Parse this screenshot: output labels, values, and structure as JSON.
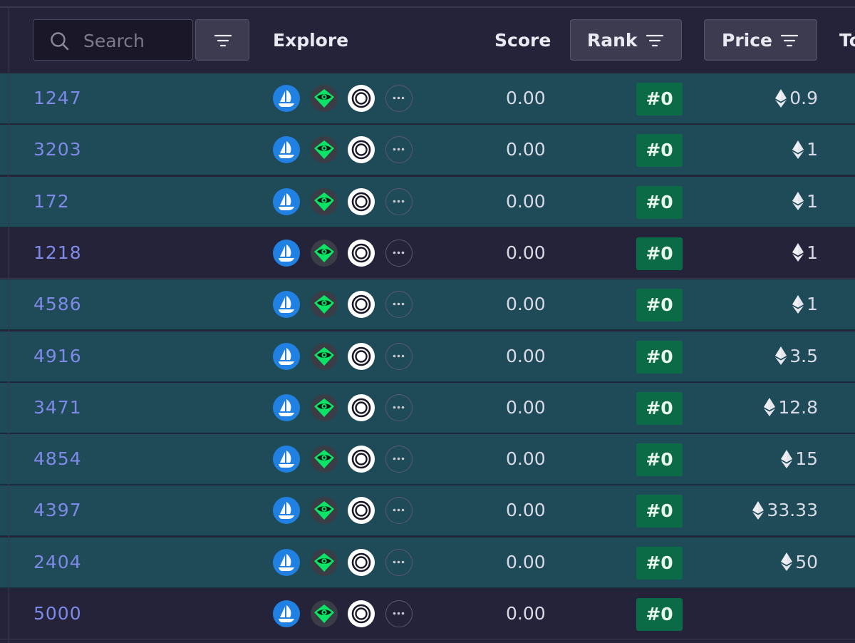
{
  "header": {
    "search_placeholder": "Search",
    "explore_label": "Explore",
    "score_label": "Score",
    "rank_label": "Rank",
    "price_label": "Price",
    "cutoff_label": "To"
  },
  "rows": [
    {
      "id": "1247",
      "score": "0.00",
      "rank": "#0",
      "price": "0.9",
      "selected": true
    },
    {
      "id": "3203",
      "score": "0.00",
      "rank": "#0",
      "price": "1",
      "selected": true
    },
    {
      "id": "172",
      "score": "0.00",
      "rank": "#0",
      "price": "1",
      "selected": true
    },
    {
      "id": "1218",
      "score": "0.00",
      "rank": "#0",
      "price": "1",
      "selected": false
    },
    {
      "id": "4586",
      "score": "0.00",
      "rank": "#0",
      "price": "1",
      "selected": true
    },
    {
      "id": "4916",
      "score": "0.00",
      "rank": "#0",
      "price": "3.5",
      "selected": true
    },
    {
      "id": "3471",
      "score": "0.00",
      "rank": "#0",
      "price": "12.8",
      "selected": true
    },
    {
      "id": "4854",
      "score": "0.00",
      "rank": "#0",
      "price": "15",
      "selected": true
    },
    {
      "id": "4397",
      "score": "0.00",
      "rank": "#0",
      "price": "33.33",
      "selected": true
    },
    {
      "id": "2404",
      "score": "0.00",
      "rank": "#0",
      "price": "50",
      "selected": true
    },
    {
      "id": "5000",
      "score": "0.00",
      "rank": "#0",
      "price": "",
      "selected": false
    }
  ],
  "explore_icons": [
    "opensea-icon",
    "looksrare-eye-icon",
    "x2y2-ring-icon",
    "more-options-icon"
  ],
  "colors": {
    "background": "#25233a",
    "selected_row": "#1f4b59",
    "rank_badge": "#0b6b47",
    "id_link": "#7e8ae8",
    "opensea_blue": "#2081e2",
    "looksrare_green": "#0ce466"
  }
}
